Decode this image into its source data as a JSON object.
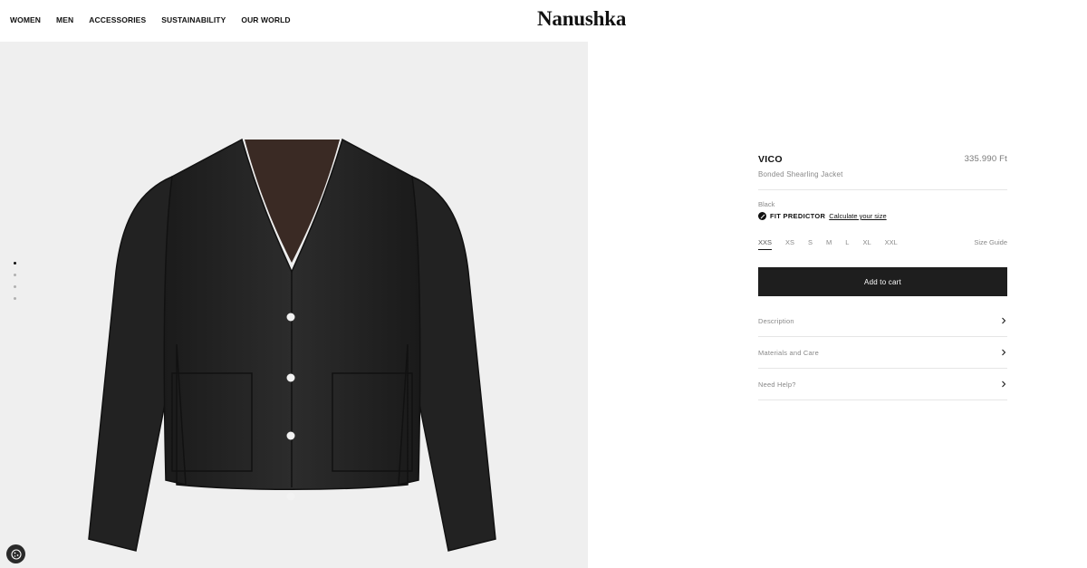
{
  "header": {
    "nav": [
      "WOMEN",
      "MEN",
      "ACCESSORIES",
      "SUSTAINABILITY",
      "OUR WORLD"
    ],
    "logo": "Nanushka"
  },
  "gallery": {
    "image_count": 4,
    "active_index": 0,
    "cookie_icon": "cookie-icon"
  },
  "product": {
    "name": "VICO",
    "price": "335.990 Ft",
    "subtitle": "Bonded Shearling Jacket",
    "color": "Black",
    "fit_predictor_label": "FIT PREDICTOR",
    "fit_predictor_link": "Calculate your size",
    "sizes": [
      "XXS",
      "XS",
      "S",
      "M",
      "L",
      "XL",
      "XXL"
    ],
    "selected_size": "XXS",
    "size_guide": "Size Guide",
    "add_to_cart": "Add to cart",
    "accordions": [
      "Description",
      "Materials and Care",
      "Need Help?"
    ]
  },
  "colors": {
    "button_bg": "#1e1e1e",
    "gallery_bg": "#efefef",
    "muted_text": "#888888"
  }
}
